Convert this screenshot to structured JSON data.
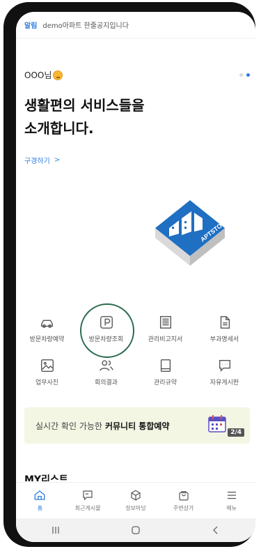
{
  "notice": {
    "label": "알림",
    "text": "demo아파트 한줄공지입니다"
  },
  "greeting": {
    "name": "OOO님",
    "emoji": "sweat-smile-emoji"
  },
  "carousel": {
    "total": 2,
    "active_index": 2
  },
  "headline": {
    "line1": "생활편의 서비스들을",
    "line2": "소개합니다."
  },
  "subscribe_link": "구경하기",
  "logo_text": "APTSTORY",
  "services": [
    {
      "label": "방문차량예약",
      "icon": "car-icon"
    },
    {
      "label": "방문차량조회",
      "icon": "parking-icon"
    },
    {
      "label": "관리비고지서",
      "icon": "bill-icon"
    },
    {
      "label": "부과명세서",
      "icon": "document-icon"
    },
    {
      "label": "업무사진",
      "icon": "photo-icon"
    },
    {
      "label": "회의결과",
      "icon": "people-icon"
    },
    {
      "label": "관리규약",
      "icon": "book-icon"
    },
    {
      "label": "자유게시판",
      "icon": "chat-icon"
    }
  ],
  "banner": {
    "prefix": "실시간 확인 가능한",
    "bold": "커뮤니티 통합예약",
    "counter": "2/4"
  },
  "mylist_title": "MY리스트",
  "tabs": [
    {
      "label": "홈",
      "icon": "home-icon",
      "active": true
    },
    {
      "label": "최근게시물",
      "icon": "quote-icon",
      "active": false
    },
    {
      "label": "정보마당",
      "icon": "cube-icon",
      "active": false
    },
    {
      "label": "주변상가",
      "icon": "bag-icon",
      "active": false
    },
    {
      "label": "메뉴",
      "icon": "menu-icon",
      "active": false
    }
  ],
  "colors": {
    "accent": "#2f7de1",
    "highlight_circle": "#2a6b4d",
    "banner_bg": "#f4f6e4"
  }
}
